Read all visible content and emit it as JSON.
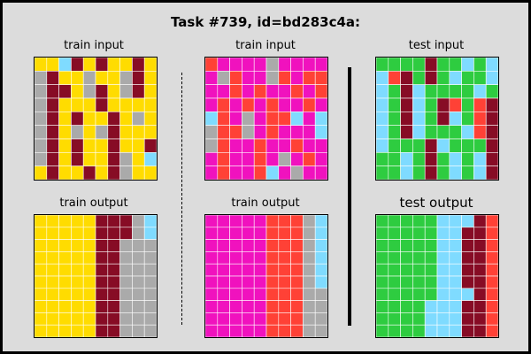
{
  "title": "Task #739, id=bd283c4a:",
  "colors": {
    "Y": "#ffdc00",
    "M": "#870c25",
    "G": "#aaaaaa",
    "C": "#7fdbff",
    "P": "#f012be",
    "R": "#ff4136",
    "N": "#2ecc40",
    "grid_line": "#ffffff",
    "background": "#dcdcdc"
  },
  "panels": [
    {
      "title": "train input",
      "rows": [
        "YYCMYMYYMY",
        "GMYYGYYGMY",
        "GMMYGMYGMY",
        "GMYYYMYYYY",
        "GMYMYYMYGY",
        "GMYGYGMYYY",
        "GMYMYYMYYM",
        "GMYMYYMGYC",
        "YMYYMYMGYY"
      ]
    },
    {
      "title": "train input",
      "rows": [
        "RPPPPGPPPP",
        "PGRPPGRPRR",
        "PPRPRPPRPR",
        "PRPRPRPPRP",
        "CRPGPRRCPC",
        "GRRGPRPPPC",
        "GRPPRPPRPP",
        "PRPPRPGPRP",
        "PRPPRCPGPP"
      ]
    },
    {
      "title": "test input",
      "rows": [
        "NNNNMNNCNC",
        "CRMNMNCNNC",
        "CNMCNNNNCN",
        "CNMCNMRNRM",
        "CNMCNMCNRM",
        "CNMCNNNCRM",
        "CNNNMCNNNM",
        "NNCNMNCNCM",
        "NNCNMNCNCM"
      ]
    },
    {
      "title": "train output",
      "rows": [
        "YYYYYMMMGC",
        "YYYYYMMMGC",
        "YYYYYMMGGG",
        "YYYYYMMGGG",
        "YYYYYMMGGG",
        "YYYYYMMGGG",
        "YYYYYMMGGG",
        "YYYYYMMGGG",
        "YYYYYMMGGG",
        "YYYYYMMGGG"
      ]
    },
    {
      "title": "train output",
      "rows": [
        "PPPPPRRRGC",
        "PPPPPRRRGC",
        "PPPPPRRRGC",
        "PPPPPRRRGC",
        "PPPPPRRRGC",
        "PPPPPRRRGC",
        "PPPPPRRRGG",
        "PPPPPRRRGG",
        "PPPPPRRRGG",
        "PPPPPRRRGG"
      ]
    },
    {
      "title": "test output",
      "rows": [
        "NNNNNCCCMR",
        "NNNNNCCMMR",
        "NNNNNCCMMR",
        "NNNNNCCMMR",
        "NNNNNCCMMR",
        "NNNNNCCMMR",
        "NNNNNCCCMR",
        "NNNNCCCMMR",
        "NNNNCCCMMR",
        "NNNNCCCMMR"
      ]
    }
  ]
}
